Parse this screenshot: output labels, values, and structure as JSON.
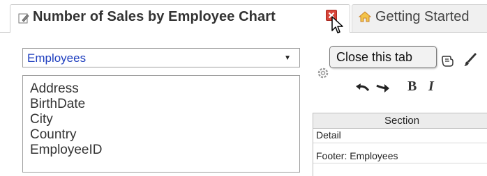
{
  "tabs": {
    "active": {
      "title": "Number of Sales by Employee Chart",
      "icon": "edit-icon"
    },
    "inactive": {
      "title": "Getting Started",
      "icon": "home-icon"
    },
    "close_icon_color": "#d8453a"
  },
  "tooltip": {
    "text": "Close this tab"
  },
  "field_select": {
    "value": "Employees"
  },
  "field_list": [
    "Address",
    "BirthDate",
    "City",
    "Country",
    "EmployeeID"
  ],
  "toolbar": {
    "bold_label": "B",
    "italic_label": "I",
    "icons": [
      "gear-icon",
      "hand-icon",
      "brush-icon",
      "undo-icon",
      "redo-icon"
    ]
  },
  "section_grid": {
    "header": "Section",
    "rows": [
      "Detail",
      "Footer: Employees"
    ]
  },
  "colors": {
    "select_text": "#1f3fbf",
    "close_button": "#d8453a"
  }
}
